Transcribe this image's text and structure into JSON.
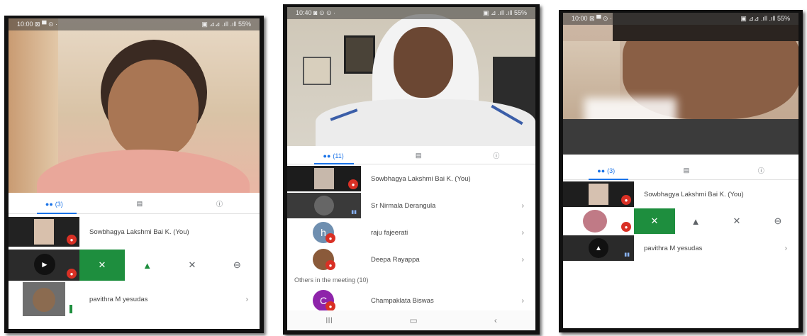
{
  "panels": [
    {
      "status_time": "10:00 ⊠ ▀ ⊙ ·",
      "status_right": "▣ ⊿⊿ .ıll .ıll 55%",
      "tabs": {
        "people": "(3)"
      },
      "rows": [
        {
          "name": "Sowbhagya Lakshmi Bai K. (You)"
        },
        {
          "name": "pavithra M yesudas",
          "chevron": "›"
        }
      ],
      "actions": {
        "close": "✕",
        "pin": "📌",
        "mute": "🎤",
        "more": "⊖"
      }
    },
    {
      "status_time": "10:40 ◙ ⊙ ⊙ ·",
      "status_right": "▣ ⊿ .ıll .ıll 55%",
      "tabs": {
        "people": "(11)"
      },
      "rows": [
        {
          "name": "Sowbhagya Lakshmi Bai K. (You)"
        },
        {
          "name": "Sr Nirmala Derangula",
          "chevron": "›"
        },
        {
          "name": "raju fajeerati",
          "initial": "h",
          "chevron": "›"
        },
        {
          "name": "Deepa Rayappa",
          "chevron": "›"
        },
        {
          "name": "Champaklata Biswas",
          "initial": "C",
          "chevron": "›"
        }
      ],
      "section": "Others in the meeting (10)",
      "nav": {
        "recent": "III",
        "home": "▭",
        "back": "‹"
      }
    },
    {
      "status_time": "10:00 ⊠ ▀ ⊙ ·",
      "status_right": "▣ ⊿⊿ .ıll .ıll 55%",
      "tabs": {
        "people": "(3)"
      },
      "rows": [
        {
          "name": "Sowbhagya Lakshmi Bai K. (You)"
        },
        {
          "name": "pavithra M yesudas",
          "chevron": "›"
        }
      ],
      "actions": {
        "close": "✕",
        "pin": "📌",
        "mute": "🎤",
        "more": "⊖"
      }
    }
  ],
  "colors": {
    "accent": "#1a73e8",
    "green": "#1e8e3e",
    "mute": "#d93025"
  },
  "icons": {
    "people": "people-icon",
    "chat": "chat-icon",
    "info": "info-icon"
  }
}
